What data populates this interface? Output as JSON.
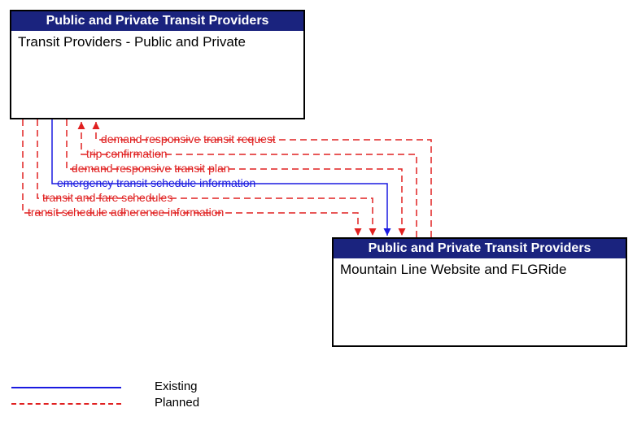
{
  "boxes": {
    "top": {
      "header": "Public and Private Transit Providers",
      "body": "Transit Providers - Public and Private"
    },
    "bottom": {
      "header": "Public and Private Transit Providers",
      "body": "Mountain Line Website and FLGRide"
    }
  },
  "flows": [
    {
      "label": "demand responsive transit request",
      "style": "planned",
      "direction": "to_top"
    },
    {
      "label": "trip confirmation",
      "style": "planned",
      "direction": "to_top"
    },
    {
      "label": "demand responsive transit plan",
      "style": "planned",
      "direction": "to_bottom"
    },
    {
      "label": "emergency transit schedule information",
      "style": "existing",
      "direction": "to_bottom"
    },
    {
      "label": "transit and fare schedules",
      "style": "planned",
      "direction": "to_bottom"
    },
    {
      "label": "transit schedule adherence information",
      "style": "planned",
      "direction": "to_bottom"
    }
  ],
  "legend": {
    "existing": "Existing",
    "planned": "Planned"
  }
}
